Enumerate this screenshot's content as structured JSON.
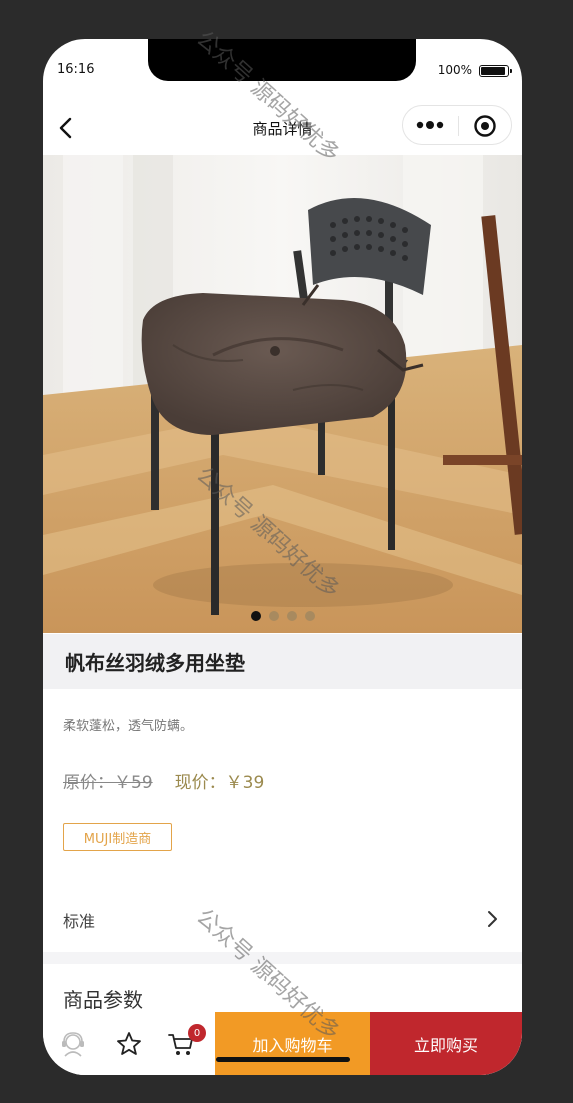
{
  "status_bar": {
    "time": "16:16",
    "battery": "100%"
  },
  "nav": {
    "title": "商品详情"
  },
  "carousel": {
    "slide_count": 4,
    "active_index": 0
  },
  "product": {
    "title": "帆布丝羽绒多用坐垫",
    "subtitle": "柔软蓬松，透气防螨。",
    "original_price": "原价：￥59",
    "current_price": "现价：￥39",
    "brand_tag": "MUJI制造商"
  },
  "spec": {
    "label": "标准"
  },
  "params": {
    "section_title": "商品参数"
  },
  "bottom_bar": {
    "cart_count": "0",
    "add_to_cart": "加入购物车",
    "buy_now": "立即购买"
  },
  "watermark": {
    "text": "公众号 源码好优多"
  },
  "colors": {
    "accent_orange": "#f29a25",
    "accent_red": "#c0272d",
    "price_gold": "#9b8a4e",
    "tag_orange": "#e3a44a"
  }
}
